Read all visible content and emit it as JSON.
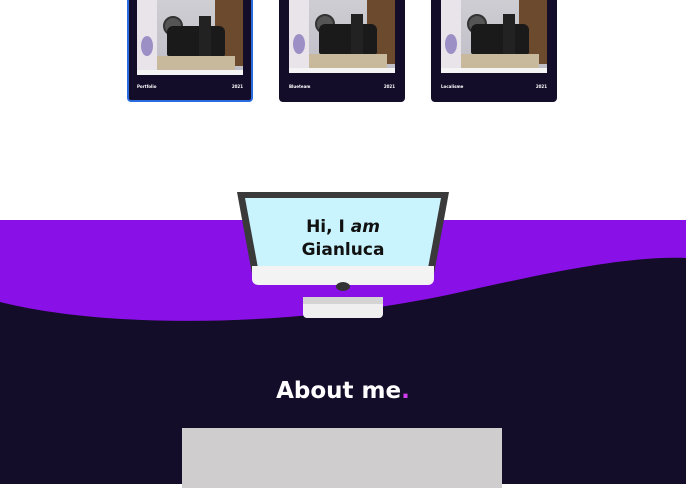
{
  "projects": [
    {
      "name": "Portfolio",
      "year": "2021",
      "active": true
    },
    {
      "name": "Blueteam",
      "year": "2021",
      "active": false
    },
    {
      "name": "Localisme",
      "year": "2021",
      "active": false
    }
  ],
  "hero": {
    "greeting_line1_prefix": "Hi, I ",
    "greeting_line1_em": "am",
    "greeting_line2": "Gianluca"
  },
  "about": {
    "title": "About me",
    "accent": "."
  },
  "colors": {
    "purple": "#8a10e8",
    "dark": "#140d29",
    "screen": "#c9f3fd",
    "accent": "#d43cf0"
  }
}
